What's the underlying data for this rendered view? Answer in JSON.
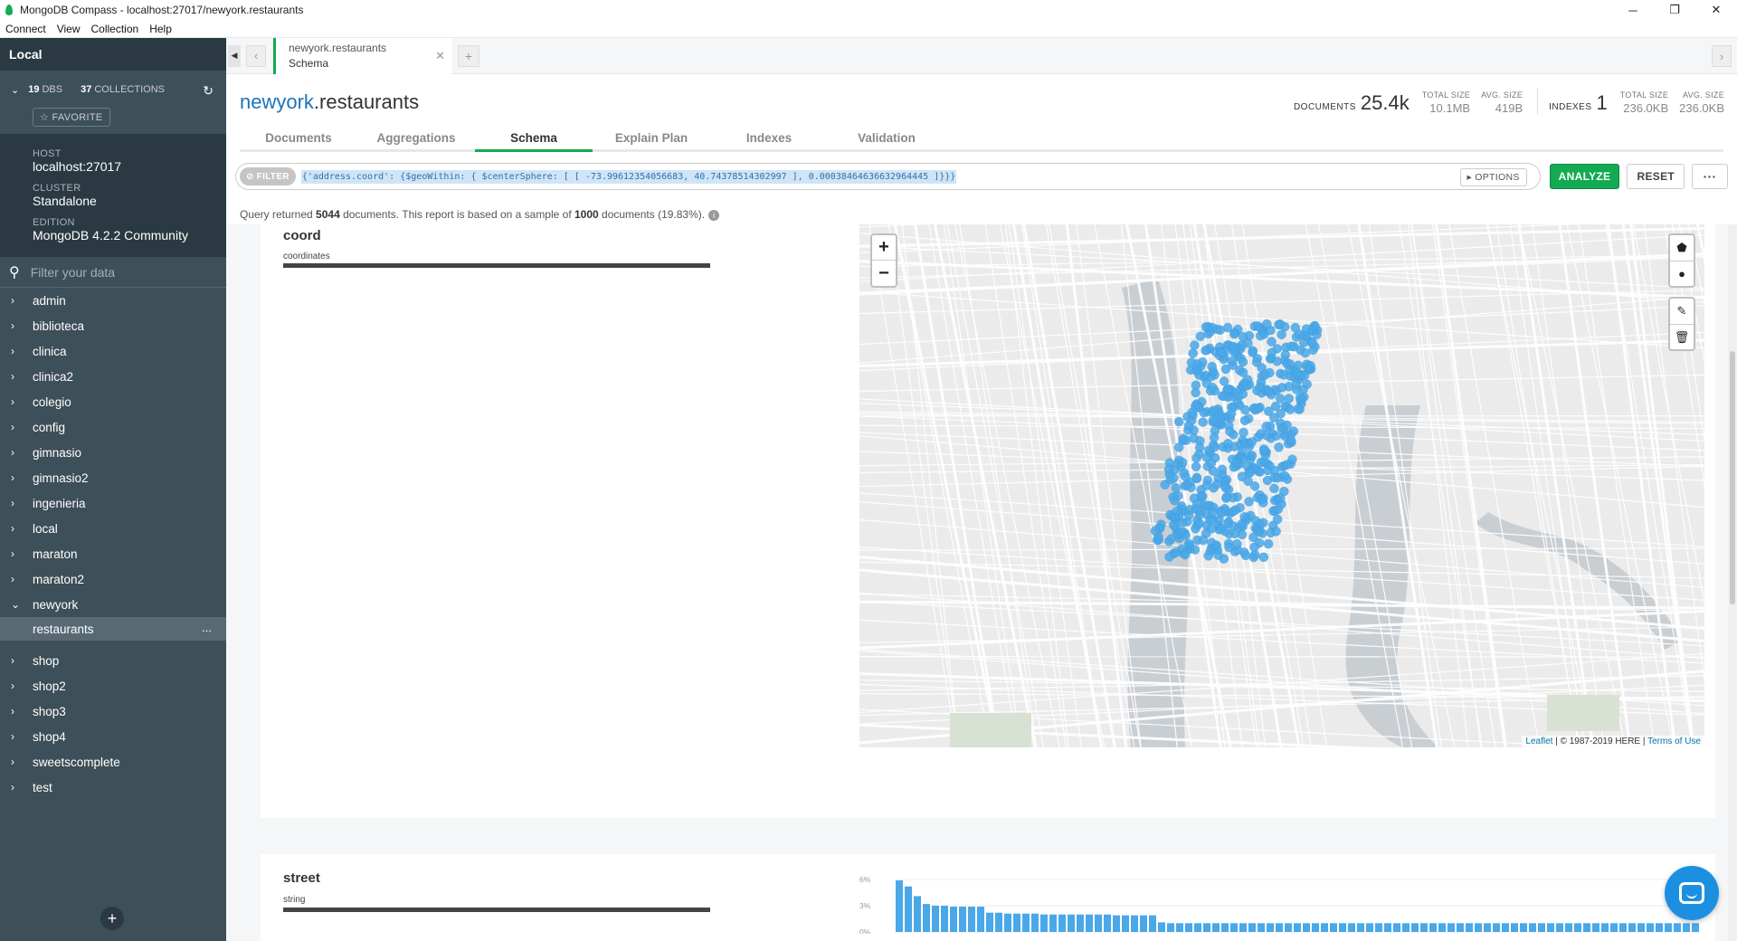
{
  "window": {
    "title": "MongoDB Compass - localhost:27017/newyork.restaurants",
    "minimize": "─",
    "maximize": "❐",
    "close": "✕"
  },
  "menu": [
    "Connect",
    "View",
    "Collection",
    "Help"
  ],
  "sidebar": {
    "connection": "Local",
    "dbs_count": "19",
    "dbs_label": "DBS",
    "collections_count": "37",
    "collections_label": "COLLECTIONS",
    "favorite_label": "☆ FAVORITE",
    "host_label": "HOST",
    "host_value": "localhost:27017",
    "cluster_label": "CLUSTER",
    "cluster_value": "Standalone",
    "edition_label": "EDITION",
    "edition_value": "MongoDB 4.2.2 Community",
    "filter_placeholder": "Filter your data",
    "databases_before": [
      "admin",
      "biblioteca",
      "clinica",
      "clinica2",
      "colegio",
      "config",
      "gimnasio",
      "gimnasio2",
      "ingenieria",
      "local",
      "maraton",
      "maraton2",
      "newyork"
    ],
    "active_collection": "restaurants",
    "databases_after": [
      "shop",
      "shop2",
      "shop3",
      "shop4",
      "sweetscomplete",
      "test"
    ]
  },
  "tab": {
    "namespace": "newyork.restaurants",
    "subtitle": "Schema"
  },
  "header": {
    "db": "newyork",
    "collection": ".restaurants",
    "documents_label": "DOCUMENTS",
    "documents_value": "25.4k",
    "total_size_label": "TOTAL SIZE",
    "total_size_value": "10.1MB",
    "avg_size_label": "AVG. SIZE",
    "avg_size_value": "419B",
    "indexes_label": "INDEXES",
    "indexes_value": "1",
    "idx_total_size_label": "TOTAL SIZE",
    "idx_total_size_value": "236.0KB",
    "idx_avg_size_label": "AVG. SIZE",
    "idx_avg_size_value": "236.0KB"
  },
  "subtabs": [
    "Documents",
    "Aggregations",
    "Schema",
    "Explain Plan",
    "Indexes",
    "Validation"
  ],
  "active_subtab": "Schema",
  "query": {
    "badge": "⊘ FILTER",
    "filter_text": "{'address.coord': {$geoWithin: { $centerSphere: [ [ -73.99612354056683, 40.74378514302997 ], 0.00038464636632964445 ]}}}",
    "options_label": "▸ OPTIONS",
    "analyze_label": "ANALYZE",
    "reset_label": "RESET",
    "more_label": "···"
  },
  "result": {
    "prefix": "Query returned ",
    "returned": "5044",
    "middle": " documents. This report is based on a sample of ",
    "sample": "1000",
    "suffix": " documents (19.83%)."
  },
  "fields": {
    "coord": {
      "name": "coord",
      "type": "coordinates"
    },
    "street": {
      "name": "street",
      "type": "string"
    }
  },
  "map": {
    "zoom_in": "+",
    "zoom_out": "−",
    "tool_polygon": "⬟",
    "tool_circle": "●",
    "tool_edit": "✎",
    "tool_delete": "🗑",
    "attrib_leaflet": "Leaflet",
    "attrib_mid": " | © 1987-2019 HERE | ",
    "attrib_terms": "Terms of Use",
    "point_color": "#4aa8e8"
  },
  "chart_data": {
    "type": "bar",
    "title": "",
    "ylabel": "",
    "yticks": [
      "6%",
      "3%",
      "0%"
    ],
    "ylim": [
      0,
      6
    ],
    "values": [
      5.9,
      5.2,
      4.1,
      3.2,
      3.0,
      3.0,
      2.9,
      2.9,
      2.9,
      2.9,
      2.2,
      2.2,
      2.1,
      2.1,
      2.1,
      2.1,
      2.0,
      2.0,
      2.0,
      2.0,
      2.0,
      2.0,
      2.0,
      2.0,
      1.9,
      1.9,
      1.9,
      1.9,
      1.9,
      1.1,
      1.0,
      1.0,
      1.0,
      1.0,
      1.0,
      1.0,
      1.0,
      1.0,
      1.0,
      1.0,
      1.0,
      1.0,
      1.0,
      1.0,
      1.0,
      1.0,
      1.0,
      1.0,
      1.0,
      1.0,
      1.0,
      1.0,
      1.0,
      1.0,
      1.0,
      1.0,
      1.0,
      1.0,
      1.0,
      1.0,
      1.0,
      1.0,
      1.0,
      1.0,
      1.0,
      1.0,
      1.0,
      1.0,
      1.0,
      1.0,
      1.0,
      1.0,
      1.0,
      1.0,
      1.0,
      1.0,
      1.0,
      1.0,
      1.0,
      1.0,
      1.0,
      1.0,
      1.0,
      1.0,
      1.0,
      1.0,
      1.0,
      1.0,
      1.0
    ],
    "bar_color": "#4aa8e8"
  }
}
